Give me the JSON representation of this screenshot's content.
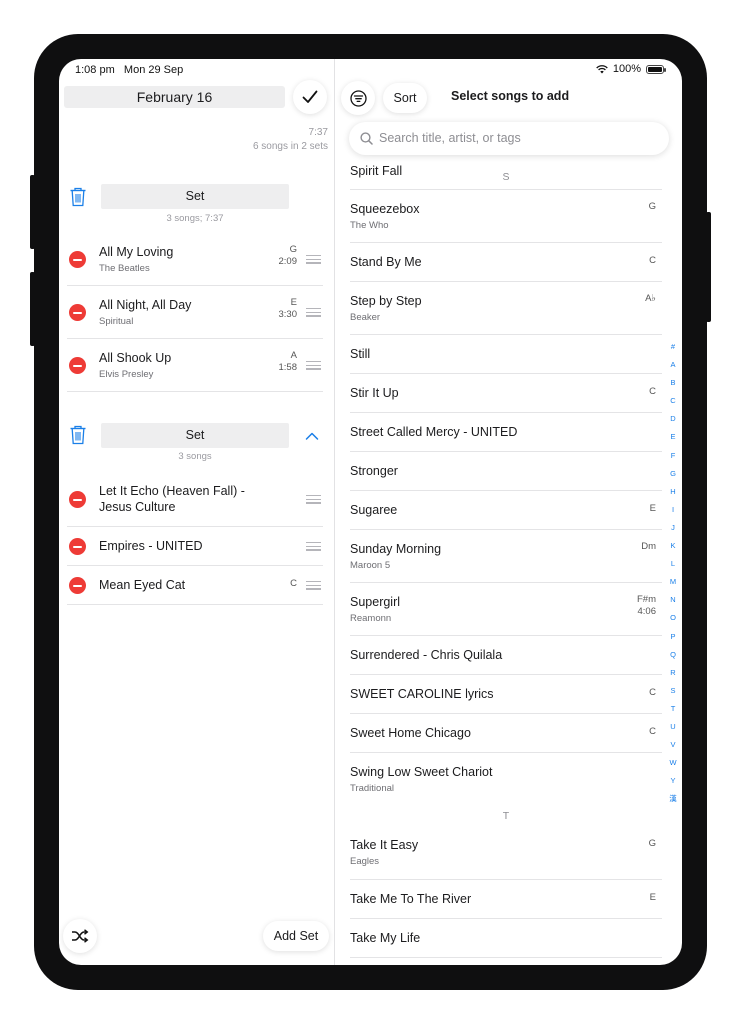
{
  "status": {
    "time": "1:08 pm",
    "date": "Mon 29 Sep",
    "battery": "100%"
  },
  "setlist": {
    "title": "February 16",
    "duration": "7:37",
    "summary": "6 songs in 2 sets",
    "sets": [
      {
        "title": "Set",
        "subtitle": "3 songs; 7:37",
        "songs": [
          {
            "title": "All My Loving",
            "artist": "The Beatles",
            "key": "G",
            "duration": "2:09"
          },
          {
            "title": "All Night, All Day",
            "artist": "Spiritual",
            "key": "E",
            "duration": "3:30"
          },
          {
            "title": "All Shook Up",
            "artist": "Elvis Presley",
            "key": "A",
            "duration": "1:58"
          }
        ]
      },
      {
        "title": "Set",
        "subtitle": "3 songs",
        "songs": [
          {
            "title_line1": "Let It Echo (Heaven Fall) -",
            "title_line2": "Jesus Culture"
          },
          {
            "title": "Empires - UNITED"
          },
          {
            "title": "Mean Eyed Cat",
            "key": "C"
          }
        ]
      }
    ],
    "add_set_label": "Add Set"
  },
  "picker": {
    "sort_label": "Sort",
    "title": "Select songs to add",
    "search_placeholder": "Search title, artist, or tags",
    "songs": [
      {
        "title": "Spirit Fall"
      },
      {
        "title": "Squeezebox",
        "artist": "The Who",
        "key": "G"
      },
      {
        "title": "Stand By Me",
        "key": "C"
      },
      {
        "title": "Step by Step",
        "artist": "Beaker",
        "key": "A♭"
      },
      {
        "title": "Still"
      },
      {
        "title": "Stir It Up",
        "key": "C"
      },
      {
        "title": "Street Called Mercy - UNITED"
      },
      {
        "title": "Stronger"
      },
      {
        "title": "Sugaree",
        "key": "E"
      },
      {
        "title": "Sunday Morning",
        "artist": "Maroon 5",
        "key": "Dm"
      },
      {
        "title": "Supergirl",
        "artist": "Reamonn",
        "key": "F#m",
        "duration": "4:06"
      },
      {
        "title": "Surrendered - Chris Quilala"
      },
      {
        "title": "SWEET CAROLINE lyrics",
        "key": "C"
      },
      {
        "title": "Sweet Home Chicago",
        "key": "C"
      },
      {
        "title": "Swing Low Sweet Chariot",
        "artist": "Traditional"
      },
      {
        "title": "Take It Easy",
        "artist": "Eagles",
        "key": "G"
      },
      {
        "title": "Take Me To The River",
        "key": "E"
      },
      {
        "title": "Take My Life"
      }
    ],
    "sections": [
      "S",
      "T"
    ],
    "index_letters": [
      "#",
      "A",
      "B",
      "C",
      "D",
      "E",
      "F",
      "G",
      "H",
      "I",
      "J",
      "K",
      "L",
      "M",
      "N",
      "O",
      "P",
      "Q",
      "R",
      "S",
      "T",
      "U",
      "V",
      "W",
      "Y",
      "漢"
    ]
  },
  "colors": {
    "accent": "#1a7fe8",
    "delete": "#ee3b36"
  }
}
